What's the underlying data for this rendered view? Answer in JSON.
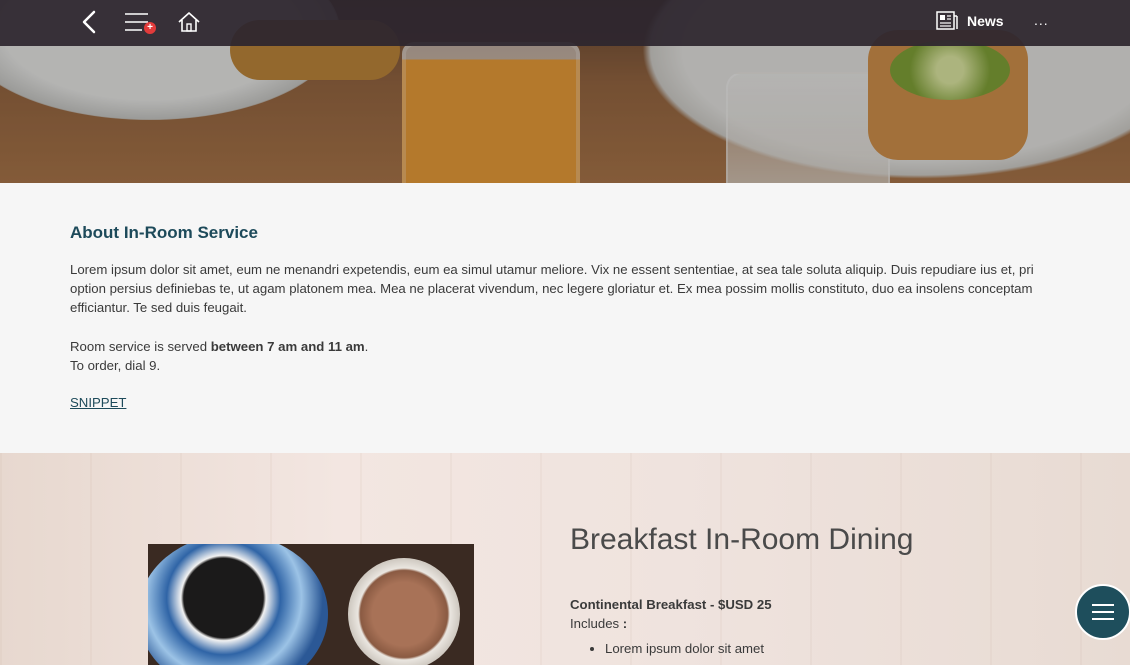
{
  "topbar": {
    "back_icon": "chevron-left-icon",
    "menu_icon": "list-menu-icon",
    "menu_badge": "+",
    "home_icon": "home-icon",
    "news_label": "News",
    "more_label": "..."
  },
  "about": {
    "title": "About In-Room Service",
    "paragraph": "Lorem ipsum dolor sit amet, eum ne menandri expetendis, eum ea simul utamur meliore. Vix ne essent sententiae, at sea tale soluta aliquip. Duis repudiare ius et, pri option persius definiebas te, ut agam platonem mea. Mea ne placerat vivendum, nec legere gloriatur et. Ex mea possim mollis constituto, duo ea insolens conceptam efficiantur. Te sed duis feugait.",
    "hours_prefix": "Room service is served ",
    "hours_bold": "between 7 am and 11 am",
    "hours_suffix": ".",
    "order_text": "To order, dial 9.",
    "snippet_link": "SNIPPET"
  },
  "breakfast": {
    "title": "Breakfast In-Room Dining",
    "item_title": "Continental Breakfast - $USD 25",
    "includes_label": "Includes",
    "includes_colon": ":",
    "items": [
      "Lorem ipsum dolor sit amet"
    ]
  },
  "colors": {
    "accent": "#1d4a5a",
    "topbar": "#2d262e",
    "badge": "#e23b3b"
  }
}
